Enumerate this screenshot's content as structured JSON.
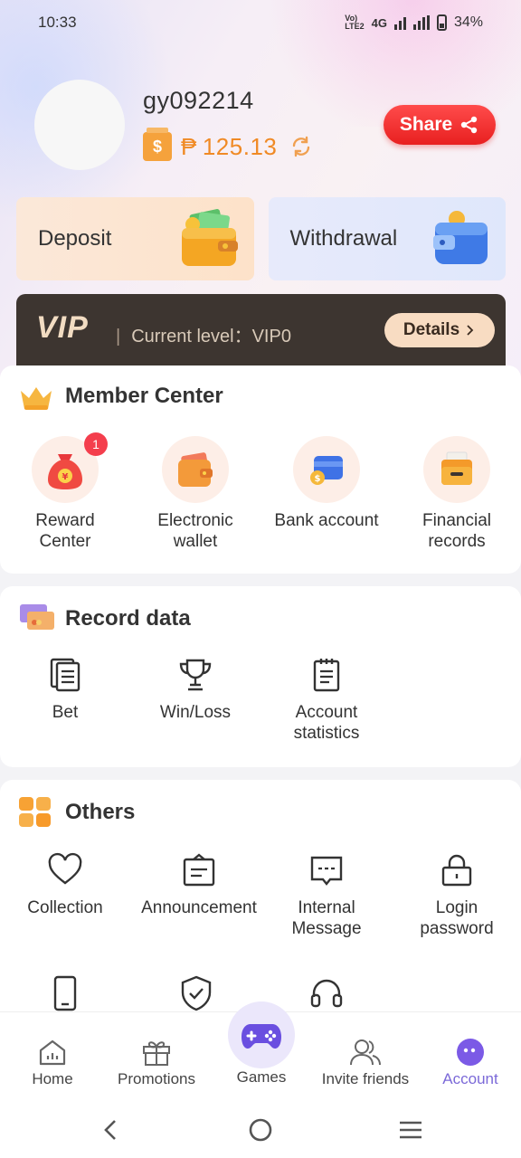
{
  "status_bar": {
    "time": "10:33",
    "network": "4G",
    "volte": "VoLTE2",
    "battery": "34%"
  },
  "profile": {
    "username": "gy092214",
    "currency_symbol": "₱",
    "balance": "125.13",
    "share_label": "Share"
  },
  "wallet_cards": {
    "deposit_label": "Deposit",
    "withdrawal_label": "Withdrawal"
  },
  "vip": {
    "logo": "VIP",
    "separator": "|",
    "current_level": "Current level：VIP0",
    "details_label": "Details"
  },
  "member_center": {
    "title": "Member Center",
    "items": [
      {
        "label_line1": "Reward",
        "label_line2": "Center",
        "badge": "1",
        "icon": "money-bag-icon"
      },
      {
        "label_line1": "Electronic",
        "label_line2": "wallet",
        "icon": "wallet-icon"
      },
      {
        "label_line1": "Bank account",
        "label_line2": "",
        "icon": "bank-card-icon"
      },
      {
        "label_line1": "Financial",
        "label_line2": "records",
        "icon": "folder-icon"
      }
    ]
  },
  "record_data": {
    "title": "Record data",
    "items": [
      {
        "label_line1": "Bet",
        "label_line2": "",
        "icon": "documents-icon"
      },
      {
        "label_line1": "Win/Loss",
        "label_line2": "",
        "icon": "trophy-icon"
      },
      {
        "label_line1": "Account",
        "label_line2": "statistics",
        "icon": "clipboard-icon"
      }
    ]
  },
  "others": {
    "title": "Others",
    "items": [
      {
        "label_line1": "Collection",
        "label_line2": "",
        "icon": "heart-icon"
      },
      {
        "label_line1": "Announcement",
        "label_line2": "",
        "icon": "announcement-icon"
      },
      {
        "label_line1": "Internal",
        "label_line2": "Message",
        "icon": "message-icon"
      },
      {
        "label_line1": "Login",
        "label_line2": "password",
        "icon": "lock-icon"
      }
    ],
    "partial_icons": [
      "phone-icon",
      "shield-check-icon",
      "headset-icon"
    ]
  },
  "bottom_nav": {
    "home": "Home",
    "promotions": "Promotions",
    "games": "Games",
    "invite": "Invite friends",
    "account": "Account",
    "active": "account",
    "active_color": "#7b69d8"
  }
}
